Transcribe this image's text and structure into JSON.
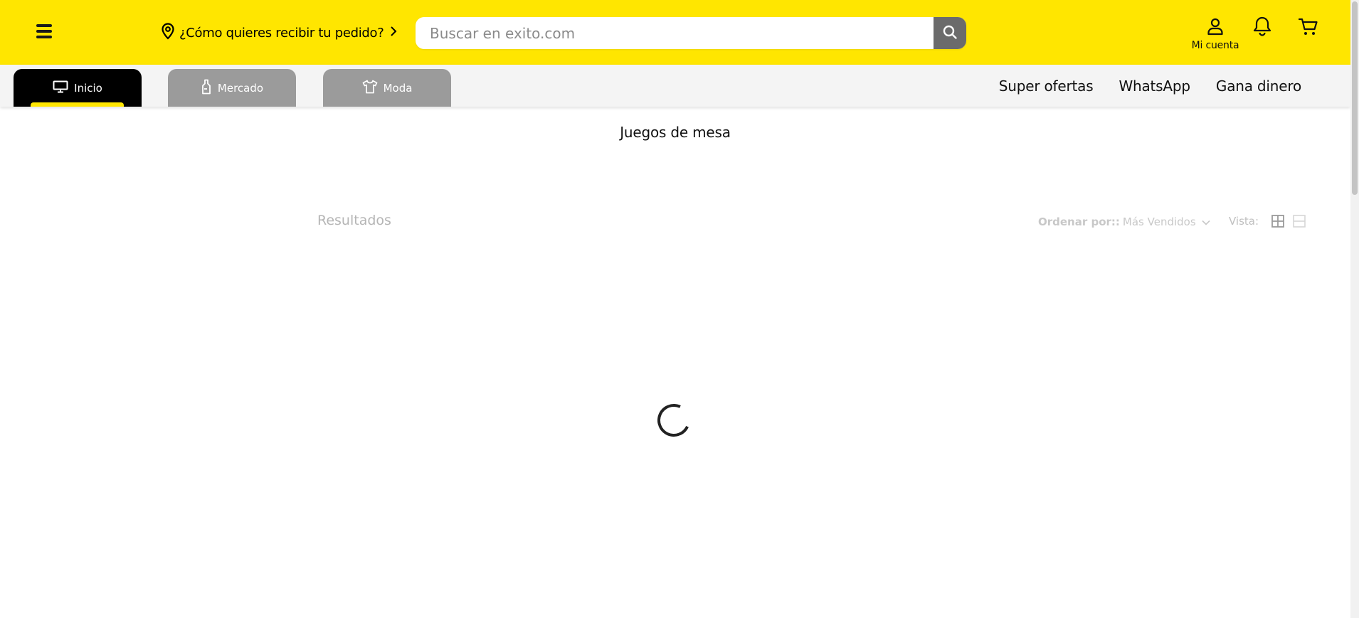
{
  "header": {
    "location_text": "¿Cómo quieres recibir tu pedido?",
    "search_placeholder": "Buscar en exito.com",
    "account_label": "Mi cuenta"
  },
  "nav": {
    "tabs": [
      {
        "label": "Inicio",
        "icon": "monitor-icon",
        "active": true
      },
      {
        "label": "Mercado",
        "icon": "bottle-icon",
        "active": false
      },
      {
        "label": "Moda",
        "icon": "shirt-icon",
        "active": false
      }
    ],
    "links": [
      "Super ofertas",
      "WhatsApp",
      "Gana dinero"
    ]
  },
  "content": {
    "title": "Juegos de mesa",
    "results_label": "Resultados",
    "sort_label": "Ordenar por::",
    "sort_value": "Más Vendidos",
    "view_label": "Vista:"
  },
  "colors": {
    "brand_yellow": "#ffe600",
    "active_tab": "#000000",
    "inactive_tab": "#9b9b9b",
    "search_button": "#6b6b6b"
  }
}
